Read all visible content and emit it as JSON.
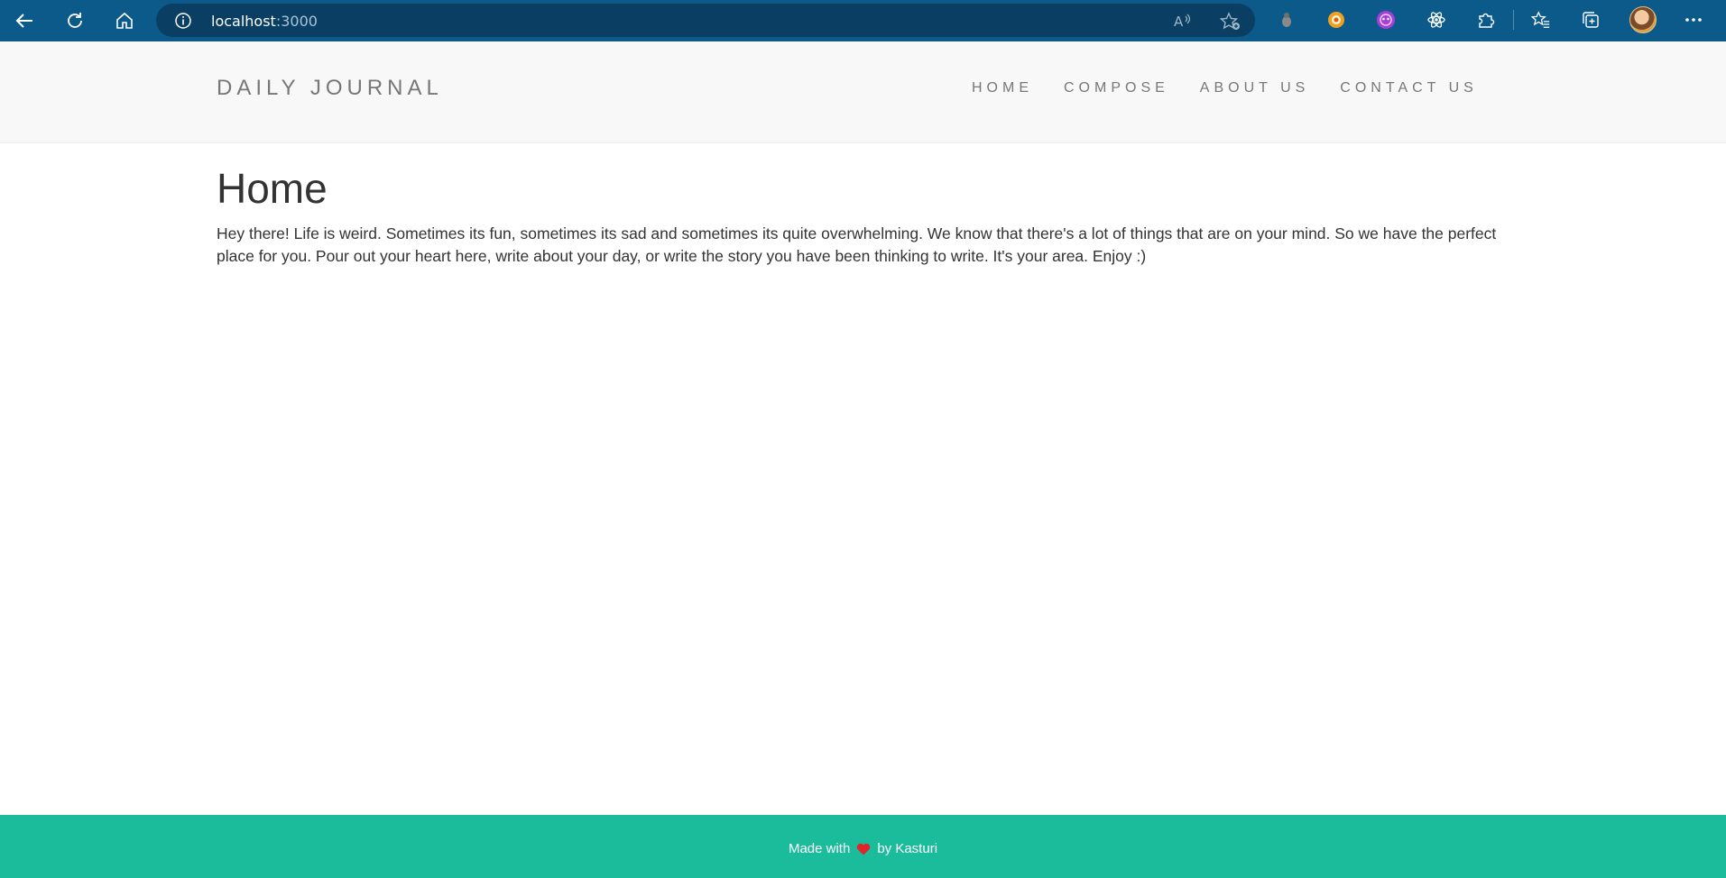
{
  "browser": {
    "url_host": "localhost",
    "url_port": ":3000"
  },
  "header": {
    "brand": "DAILY JOURNAL",
    "nav": [
      {
        "label": "HOME"
      },
      {
        "label": "COMPOSE"
      },
      {
        "label": "ABOUT US"
      },
      {
        "label": "CONTACT US"
      }
    ]
  },
  "main": {
    "title": "Home",
    "intro": "Hey there! Life is weird. Sometimes its fun, sometimes its sad and sometimes its quite overwhelming. We know that there's a lot of things that are on your mind. So we have the perfect place for you. Pour out your heart here, write about your day, or write the story you have been thinking to write. It's your area. Enjoy :)"
  },
  "footer": {
    "made_with": "Made with",
    "by": "by Kasturi"
  },
  "colors": {
    "browser_bar": "#0c5a8a",
    "footer": "#1abc9c",
    "heart": "#e0242c"
  },
  "icons": [
    "back-arrow-icon",
    "refresh-icon",
    "home-icon",
    "info-icon",
    "read-aloud-icon",
    "favorite-add-icon",
    "extension-icon",
    "react-devtools-icon",
    "extensions-puzzle-icon",
    "favorites-icon",
    "collections-icon",
    "more-icon",
    "heart-icon"
  ]
}
